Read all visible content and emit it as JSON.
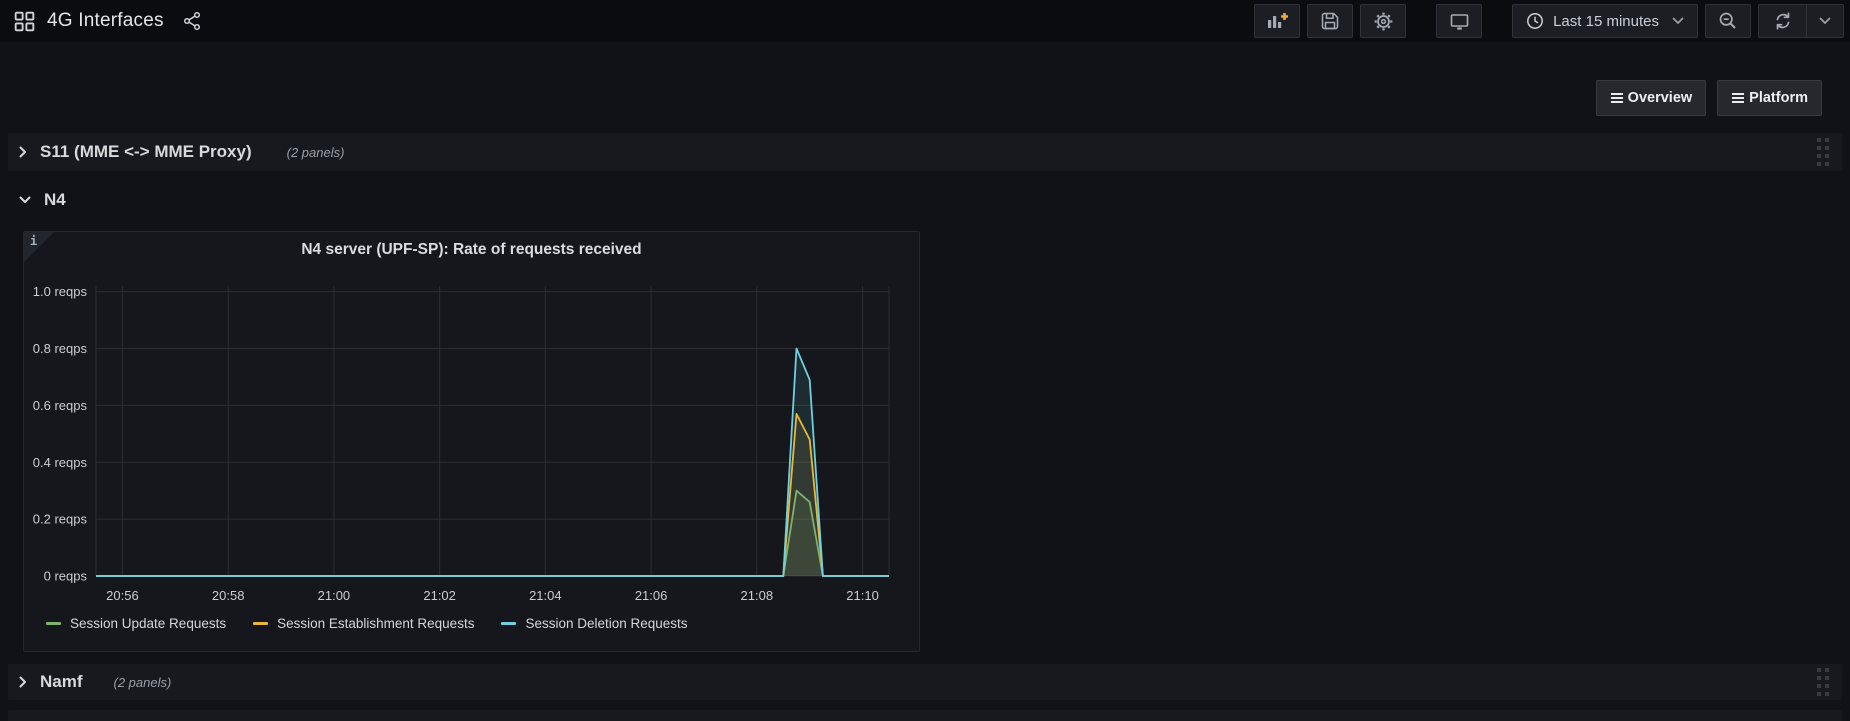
{
  "navbar": {
    "title": "4G Interfaces",
    "icons": [
      "apps-grid",
      "share-alt",
      "add-panel",
      "save",
      "settings-gear",
      "tv-monitor",
      "clock",
      "chevron-down",
      "zoom-out",
      "refresh"
    ],
    "time_picker": {
      "label": "Last 15 minutes"
    }
  },
  "colors": {
    "add_panel_plus": "#f2a83b"
  },
  "dashboard_links": [
    {
      "label": "Overview"
    },
    {
      "label": "Platform"
    }
  ],
  "rows": [
    {
      "title": "S11 (MME <-> MME Proxy)",
      "panels_count": "(2 panels)",
      "state": "collapsed"
    },
    {
      "title": "N4",
      "state": "expanded"
    },
    {
      "title": "Namf",
      "panels_count": "(2 panels)",
      "state": "collapsed"
    }
  ],
  "panel": {
    "title": "N4 server (UPF-SP): Rate of requests received",
    "info_icon": "i"
  },
  "chart_data": {
    "type": "line",
    "title": "N4 server (UPF-SP): Rate of requests received",
    "unit": "reqps",
    "time_range_label": "Last 15 minutes",
    "xlim": [
      0,
      15
    ],
    "ylim": [
      0,
      1.02
    ],
    "grid": true,
    "legend_position": "bottom",
    "x_ticks": [
      {
        "x": 0.5,
        "label": "20:56"
      },
      {
        "x": 2.5,
        "label": "20:58"
      },
      {
        "x": 4.5,
        "label": "21:00"
      },
      {
        "x": 6.5,
        "label": "21:02"
      },
      {
        "x": 8.5,
        "label": "21:04"
      },
      {
        "x": 10.5,
        "label": "21:06"
      },
      {
        "x": 12.5,
        "label": "21:08"
      },
      {
        "x": 14.5,
        "label": "21:10"
      }
    ],
    "y_ticks": [
      {
        "v": 0,
        "label": "0 reqps"
      },
      {
        "v": 0.2,
        "label": "0.2 reqps"
      },
      {
        "v": 0.4,
        "label": "0.4 reqps"
      },
      {
        "v": 0.6,
        "label": "0.6 reqps"
      },
      {
        "v": 0.8,
        "label": "0.8 reqps"
      },
      {
        "v": 1.0,
        "label": "1.0 reqps"
      }
    ],
    "series": [
      {
        "name": "Session Update Requests",
        "color": "#7eb26d",
        "points": [
          [
            0,
            0
          ],
          [
            13,
            0
          ],
          [
            13.25,
            0.3
          ],
          [
            13.5,
            0.26
          ],
          [
            13.75,
            0
          ],
          [
            15,
            0
          ]
        ]
      },
      {
        "name": "Session Establishment Requests",
        "color": "#eab839",
        "points": [
          [
            0,
            0
          ],
          [
            13,
            0
          ],
          [
            13.25,
            0.57
          ],
          [
            13.5,
            0.48
          ],
          [
            13.75,
            0
          ],
          [
            15,
            0
          ]
        ]
      },
      {
        "name": "Session Deletion Requests",
        "color": "#6ed0e0",
        "points": [
          [
            0,
            0
          ],
          [
            13,
            0
          ],
          [
            13.25,
            0.8
          ],
          [
            13.5,
            0.69
          ],
          [
            13.75,
            0
          ],
          [
            15,
            0
          ]
        ]
      }
    ]
  }
}
